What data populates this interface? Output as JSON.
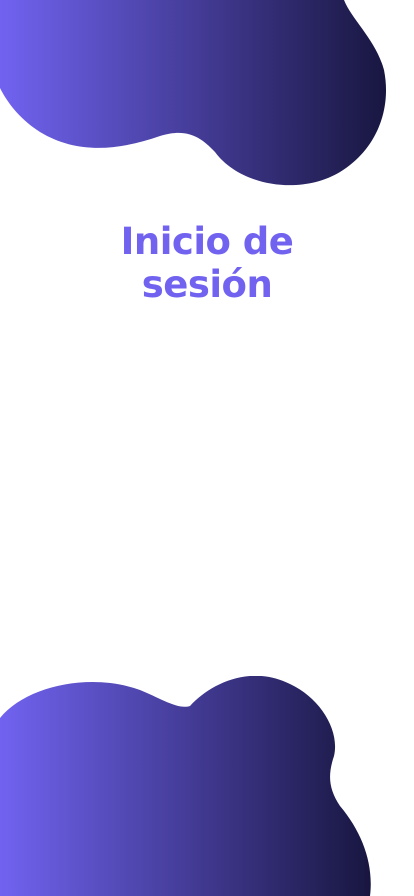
{
  "login": {
    "title_line1": "Inicio de",
    "title_line2": "sesión"
  },
  "theme": {
    "title_color": "#7163f0",
    "gradient_start": "#7163f0",
    "gradient_end": "#181640",
    "background": "#ffffff"
  }
}
